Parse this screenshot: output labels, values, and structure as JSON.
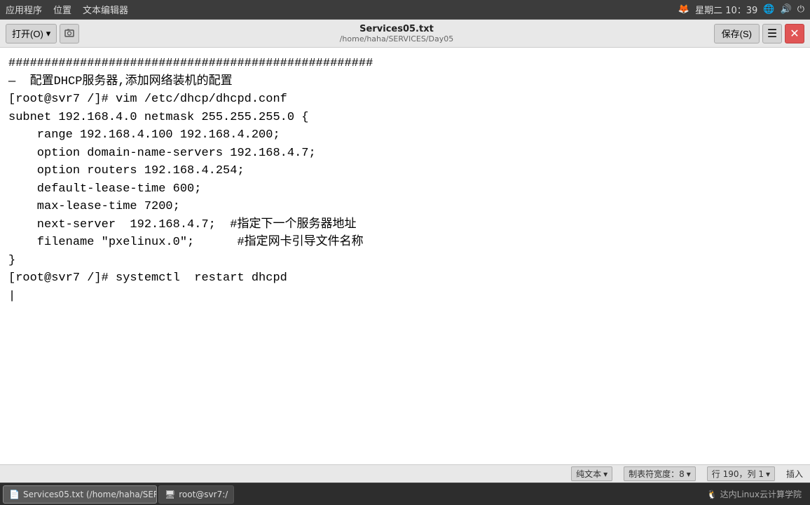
{
  "systemBar": {
    "appMenu": "应用程序",
    "locationMenu": "位置",
    "textEditor": "文本编辑器",
    "datetime": "星期二 10：39",
    "firefoxIcon": "🦊"
  },
  "toolbar": {
    "openLabel": "打开(O)",
    "saveLabel": "保存(S)",
    "fileTitle": "Services05.txt",
    "filePath": "/home/haha/SERVICES/Day05"
  },
  "editor": {
    "lines": [
      "###################################################",
      "—  配置DHCP服务器,添加网络装机的配置",
      "[root@svr7 /]# vim /etc/dhcp/dhcpd.conf",
      "subnet 192.168.4.0 netmask 255.255.255.0 {",
      "    range 192.168.4.100 192.168.4.200;",
      "    option domain-name-servers 192.168.4.7;",
      "    option routers 192.168.4.254;",
      "    default-lease-time 600;",
      "    max-lease-time 7200;",
      "    next-server  192.168.4.7;  #指定下一个服务器地址",
      "    filename \"pxelinux.0\";      #指定网卡引导文件名称",
      "}",
      "[root@svr7 /]# systemctl  restart dhcpd",
      ""
    ]
  },
  "statusBar": {
    "plainText": "纯文本",
    "tabWidth": "制表符宽度：8",
    "position": "行 190，列 1",
    "mode": "插入"
  },
  "taskbar": {
    "items": [
      {
        "label": "Services05.txt (/home/haha/SERVIC...",
        "icon": "📄",
        "active": true
      },
      {
        "label": "root@svr7:/",
        "icon": "🖥",
        "active": false
      }
    ],
    "orgName": "达内Linux云计算学院"
  }
}
